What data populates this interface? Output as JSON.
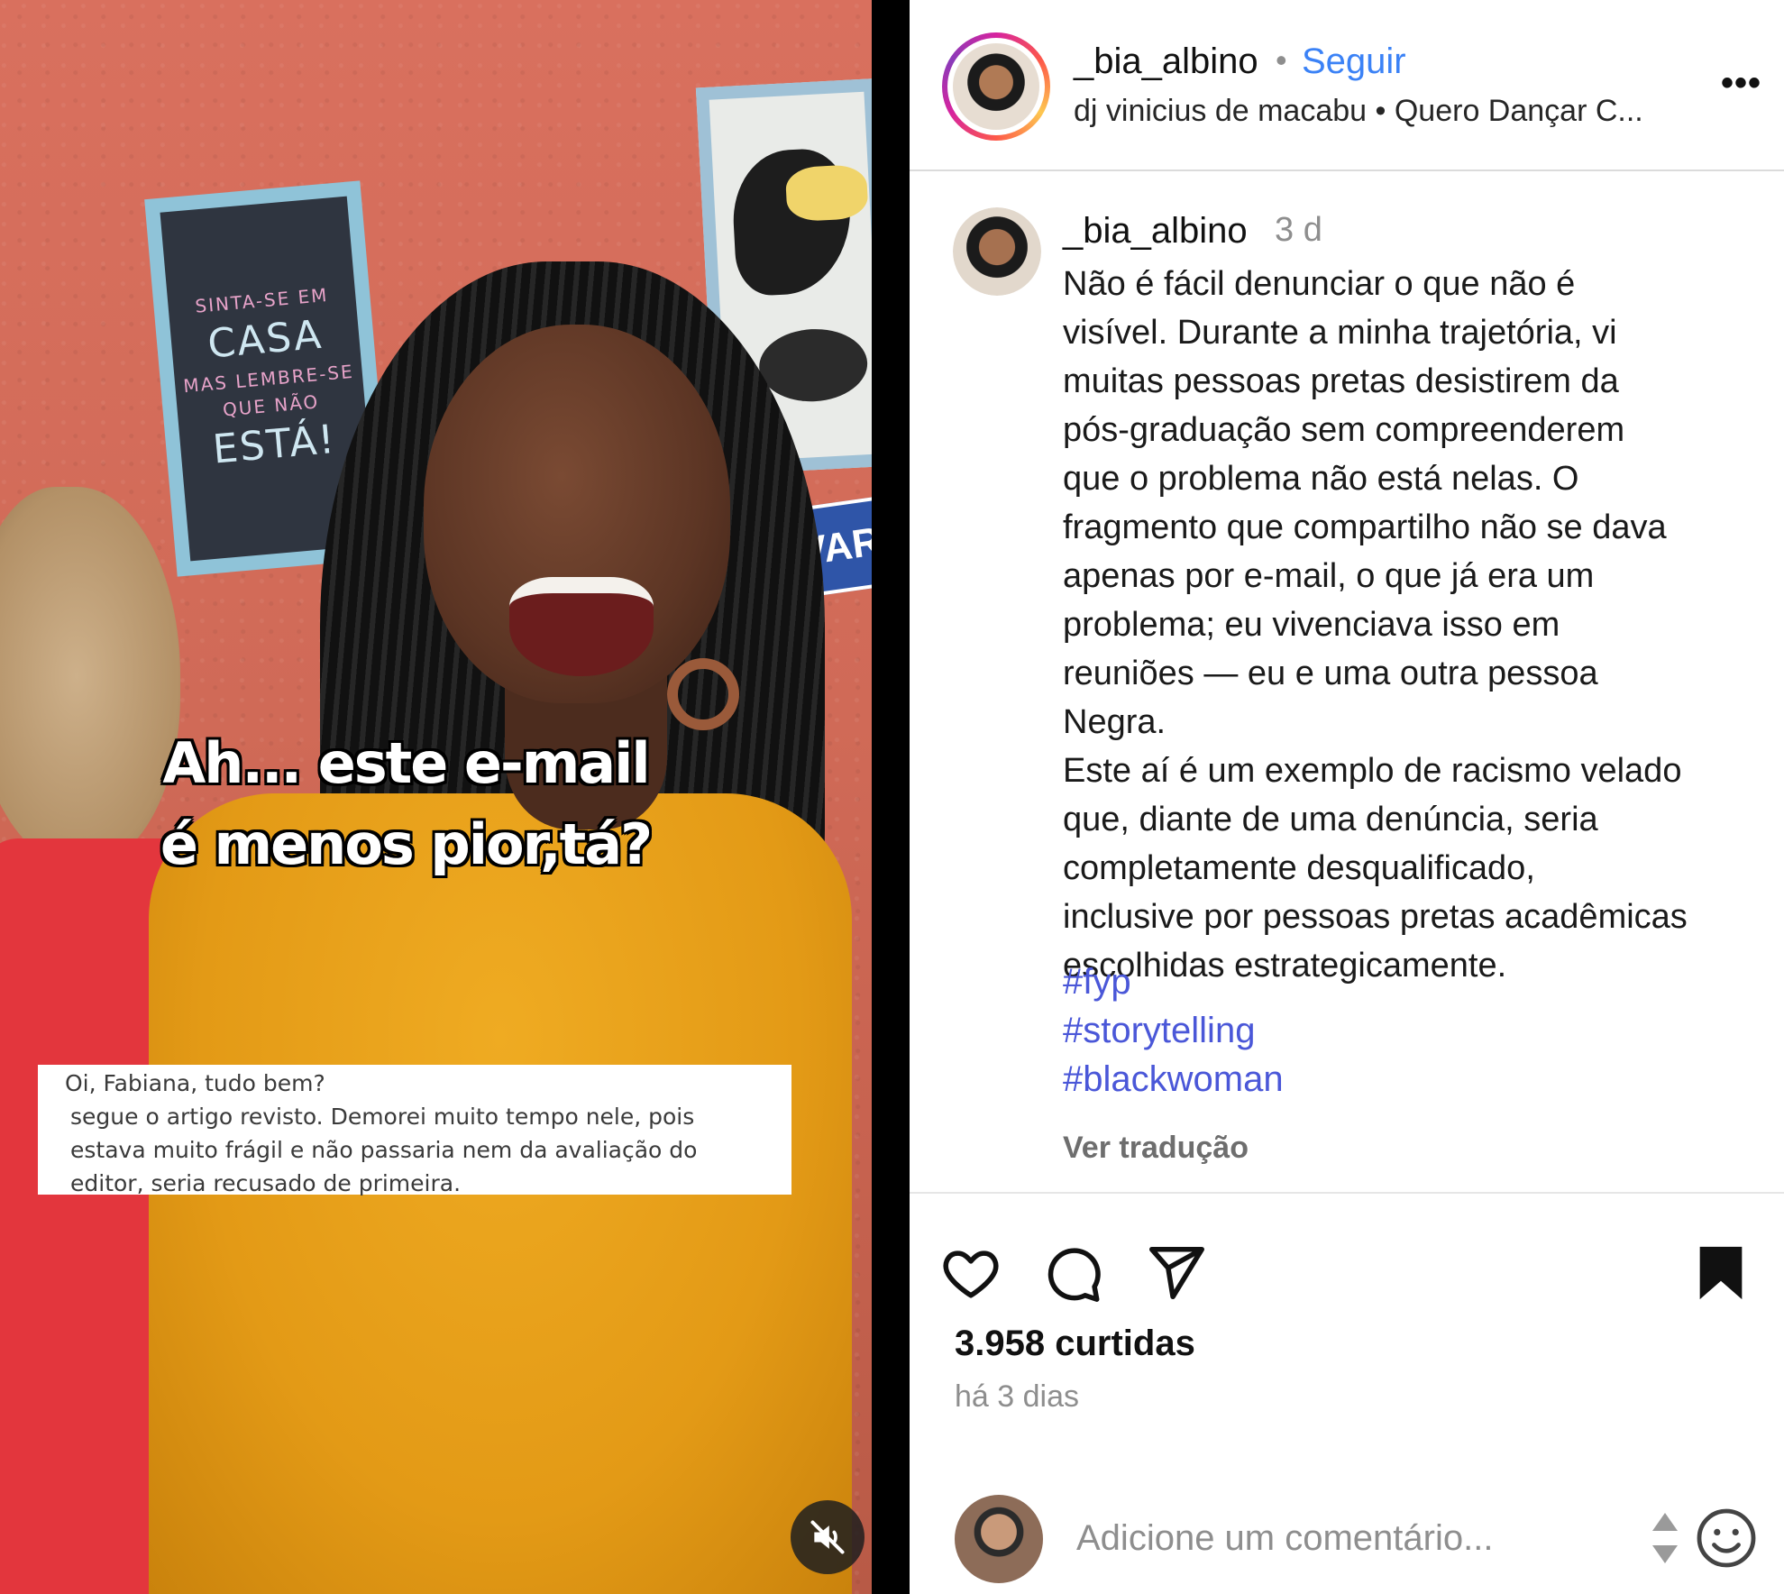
{
  "video": {
    "caption_line1": "Ah... este e-mail",
    "caption_line2": "é menos pior,tá?",
    "email_lines": [
      "Oi, Fabiana, tudo bem?",
      "segue o artigo revisto. Demorei muito tempo nele, pois",
      "estava muito frágil e não passaria nem da avaliação do",
      "editor, seria recusado de primeira."
    ],
    "poster_words": [
      "SINTA-SE EM",
      "CASA",
      "MAS LEMBRE-SE",
      "QUE NÃO",
      "ESTÁ!"
    ],
    "sign_text": "ÀVAR",
    "mute_icon": "speaker-muted-icon"
  },
  "header": {
    "username": "_bia_albino",
    "separator": "•",
    "follow_label": "Seguir",
    "subline": "dj vinicius de macabu • Quero Dançar C...",
    "more_icon": "more-options-icon",
    "more_label": "•••"
  },
  "caption": {
    "username": "_bia_albino",
    "time": "3 d",
    "text": "Não é fácil denunciar o que não é\nvisível. Durante a minha trajetória, vi\nmuitas pessoas pretas desistirem da\npós-graduação sem compreenderem\nque o problema não está nelas. O\nfragmento que compartilho não se dava\napenas por e-mail, o que já era um\nproblema; eu vivenciava isso em\nreuniões — eu e uma outra pessoa\nNegra.\nEste aí é um exemplo de racismo velado\nque, diante de uma denúncia, seria\ncompletamente desqualificado,\ninclusive por pessoas pretas acadêmicas\nescolhidas estrategicamente.",
    "hashtags": [
      "#fyp",
      "#storytelling",
      "#blackwoman"
    ],
    "translate_label": "Ver tradução"
  },
  "actions": {
    "like_icon": "heart-icon",
    "comment_icon": "comment-icon",
    "share_icon": "send-icon",
    "save_icon": "bookmark-icon",
    "likes_text": "3.958 curtidas",
    "ago_text": "há 3 dias"
  },
  "comment": {
    "placeholder": "Adicione um comentário...",
    "emoji_icon": "emoji-icon"
  },
  "colors": {
    "link_blue": "#3b82f6",
    "hashtag": "#4a57d8",
    "muted": "#8e8e8e"
  }
}
